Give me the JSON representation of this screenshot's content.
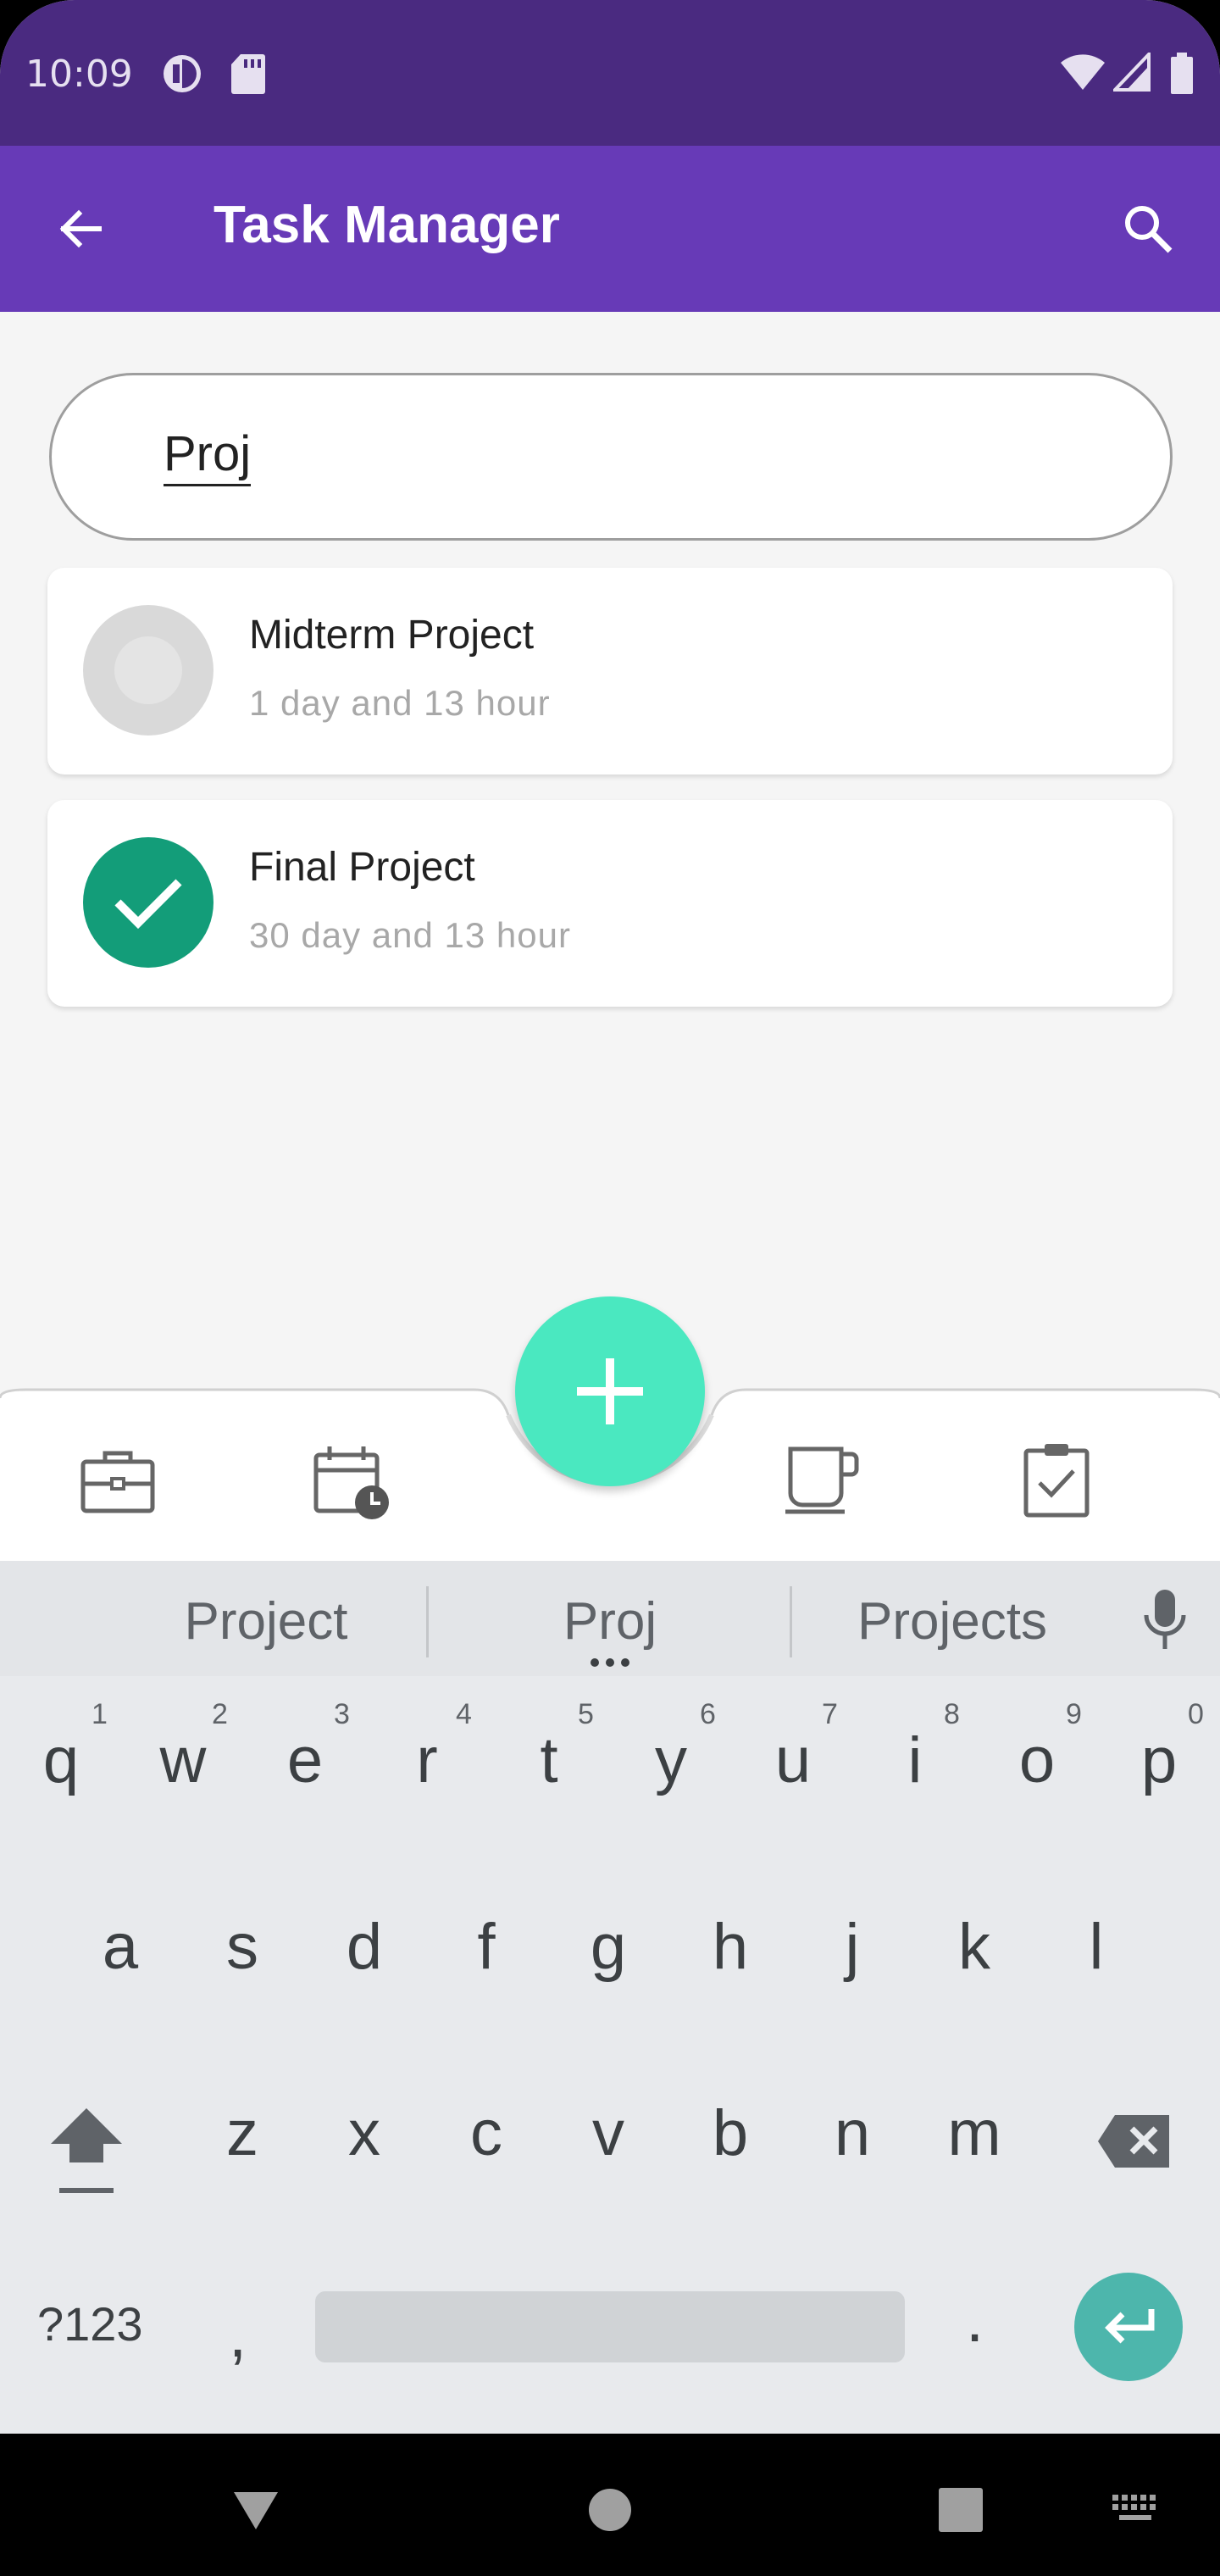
{
  "status_bar": {
    "time": "10:09"
  },
  "app_bar": {
    "title": "Task Manager"
  },
  "search": {
    "value": "Proj"
  },
  "tasks": [
    {
      "title": "Midterm Project",
      "subtitle": "1 day and 13 hour",
      "completed": false
    },
    {
      "title": "Final Project",
      "subtitle": "30 day and 13 hour",
      "completed": true
    }
  ],
  "bottom_nav": {
    "items": [
      "briefcase-icon",
      "calendar-clock-icon",
      "coffee-cup-icon",
      "clipboard-check-icon"
    ],
    "fab_icon": "plus-icon"
  },
  "keyboard": {
    "suggestions": [
      "Project",
      "Proj",
      "Projects"
    ],
    "row1": [
      "q",
      "w",
      "e",
      "r",
      "t",
      "y",
      "u",
      "i",
      "o",
      "p"
    ],
    "row1_nums": [
      "1",
      "2",
      "3",
      "4",
      "5",
      "6",
      "7",
      "8",
      "9",
      "0"
    ],
    "row2": [
      "a",
      "s",
      "d",
      "f",
      "g",
      "h",
      "j",
      "k",
      "l"
    ],
    "row3": [
      "z",
      "x",
      "c",
      "v",
      "b",
      "n",
      "m"
    ],
    "symbols_key": "?123",
    "comma": ",",
    "period": "."
  },
  "colors": {
    "status_bar": "#4a2a80",
    "app_bar": "#673ab7",
    "fab": "#4ae8c0",
    "done": "#139d79",
    "enter": "#4db6ac"
  }
}
